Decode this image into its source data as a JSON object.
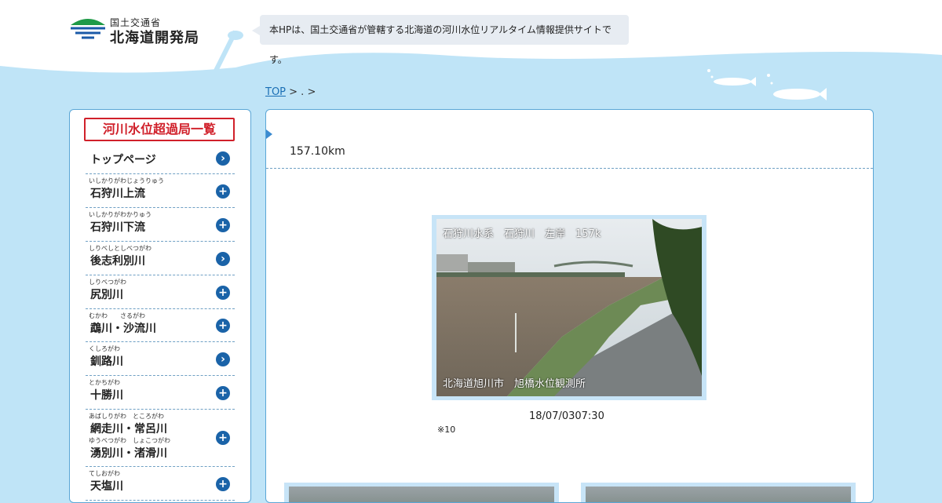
{
  "header": {
    "ministry": "国土交通省",
    "bureau": "北海道開発局",
    "notice": "本HPは、国土交通省が管轄する北海道の河川水位リアルタイム情報提供サイトです。"
  },
  "breadcrumb": {
    "top": "TOP",
    "separator": " > . >"
  },
  "sidebar": {
    "title": "河川水位超過局一覧",
    "items": [
      {
        "ruby": "",
        "label": "トップページ",
        "icon": "arrow-right-icon"
      },
      {
        "ruby": "いしかりがわじょうりゅう",
        "label": "石狩川上流",
        "icon": "plus-icon"
      },
      {
        "ruby": "いしかりがわかりゅう",
        "label": "石狩川下流",
        "icon": "plus-icon"
      },
      {
        "ruby": "しりべしとしべつがわ",
        "label": "後志利別川",
        "icon": "arrow-right-icon"
      },
      {
        "ruby": "しりべつがわ",
        "label": "尻別川",
        "icon": "plus-icon"
      },
      {
        "ruby": "むかわ　　さるがわ",
        "label": "鵡川・沙流川",
        "icon": "plus-icon"
      },
      {
        "ruby": "くしろがわ",
        "label": "釧路川",
        "icon": "arrow-right-icon"
      },
      {
        "ruby": "とかちがわ",
        "label": "十勝川",
        "icon": "plus-icon"
      },
      {
        "ruby": "あばしりがわ　ところがわ",
        "label": "網走川・常呂川",
        "ruby2": "ゆうべつがわ　しょこつがわ",
        "label2": "湧別川・渚滑川",
        "icon": "plus-icon"
      },
      {
        "ruby": "てしおがわ",
        "label": "天塩川",
        "icon": "plus-icon"
      }
    ]
  },
  "main": {
    "distance": "157.10km",
    "camera": {
      "caption_top": "石狩川水系　石狩川　左岸　157k",
      "caption_bottom": "北海道旭川市　旭橋水位観測所"
    },
    "timestamp": "18/07/0307:30",
    "note": "※10"
  }
}
